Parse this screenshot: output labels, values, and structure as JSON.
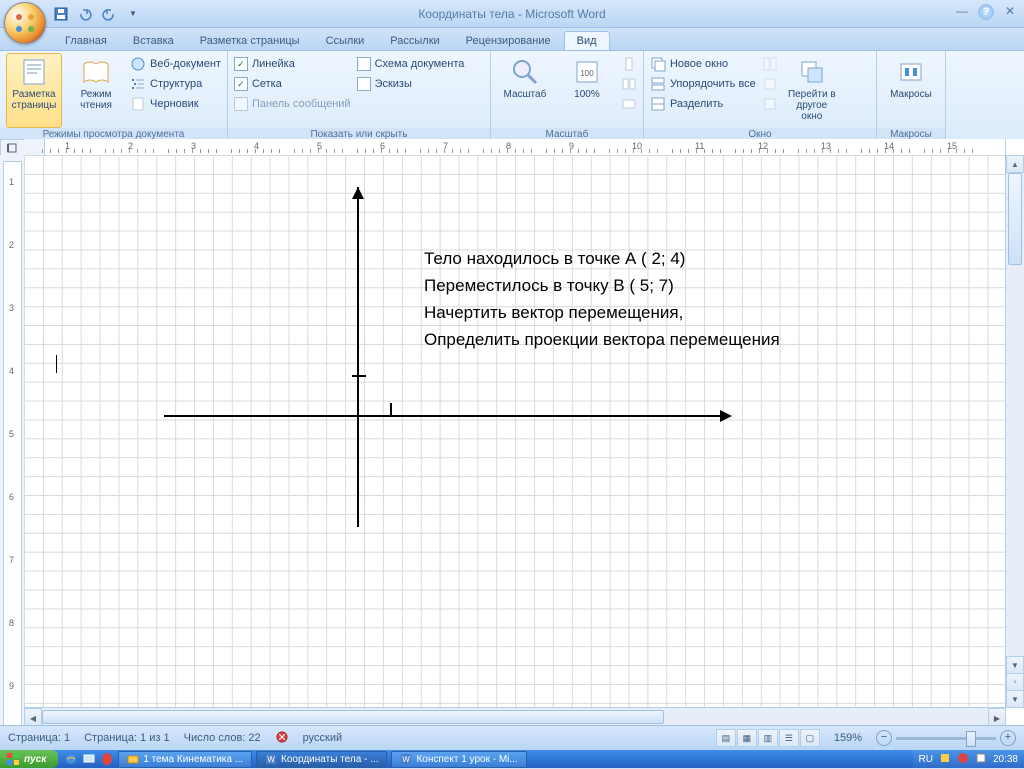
{
  "title": "Координаты тела - Microsoft Word",
  "tabs": [
    "Главная",
    "Вставка",
    "Разметка страницы",
    "Ссылки",
    "Рассылки",
    "Рецензирование",
    "Вид"
  ],
  "active_tab": 6,
  "ribbon": {
    "views": {
      "title": "Режимы просмотра документа",
      "print": "Разметка страницы",
      "read": "Режим чтения",
      "web": "Веб-документ",
      "outline": "Структура",
      "draft": "Черновик"
    },
    "show": {
      "title": "Показать или скрыть",
      "ruler": "Линейка",
      "grid": "Сетка",
      "msgbar": "Панель сообщений",
      "docmap": "Схема документа",
      "thumbs": "Эскизы"
    },
    "zoom": {
      "title": "Масштаб",
      "zoom": "Масштаб",
      "hundred": "100%"
    },
    "window": {
      "title": "Окно",
      "new": "Новое окно",
      "arrange": "Упорядочить все",
      "split": "Разделить",
      "switch": "Перейти в другое окно"
    },
    "macros": {
      "title": "Макросы",
      "macros": "Макросы"
    }
  },
  "ruler_h": [
    "1",
    "2",
    "3",
    "4",
    "5",
    "6",
    "7",
    "8",
    "9",
    "10",
    "11",
    "12",
    "13",
    "14",
    "15"
  ],
  "ruler_v": [
    "1",
    "2",
    "3",
    "4",
    "5",
    "6",
    "7",
    "8",
    "9"
  ],
  "doc_lines": [
    "Тело находилось в точке А ( 2; 4)",
    "Переместилось в точку В ( 5; 7)",
    "Начертить вектор перемещения,",
    "Определить проекции вектора перемещения"
  ],
  "status": {
    "page": "Страница: 1",
    "pageof": "Страница: 1 из 1",
    "words": "Число слов: 22",
    "lang": "русский",
    "zoom": "159%"
  },
  "taskbar": {
    "start": "пуск",
    "tasks": [
      "1 тема Кинематика ...",
      "Координаты тела - ...",
      "Конспект 1 урок - Mi..."
    ],
    "lang": "RU",
    "time": "20:38"
  }
}
